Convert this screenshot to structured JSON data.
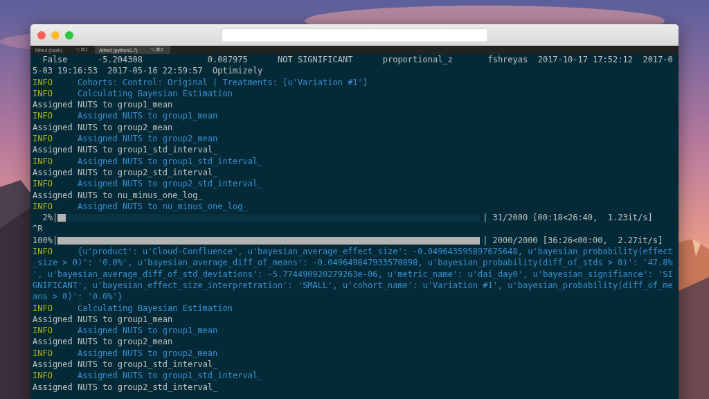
{
  "tabs": [
    {
      "label": "Alfred (bash)",
      "shortcut": "⌥⌘1",
      "selected": false
    },
    {
      "label": "Alfred (python2.7)",
      "shortcut": "⌥⌘2",
      "selected": true
    }
  ],
  "terminal": {
    "lines": [
      {
        "kind": "plain",
        "text": "  False      -5.204308             0.087975      NOT SIGNIFICANT      proportional_z       fshreyas  2017-10-17 17:52:12  2017-0"
      },
      {
        "kind": "plain",
        "text": "5-03 19:16:53  2017-05-16 22:59:57  Optimizely"
      },
      {
        "kind": "info",
        "level": "INFO",
        "text": "Cohorts: Control: Original | Treatments: [u'Variation #1']"
      },
      {
        "kind": "info",
        "level": "INFO",
        "text": "Calculating Bayesian Estimation"
      },
      {
        "kind": "plain",
        "text": "Assigned NUTS to group1_mean"
      },
      {
        "kind": "info",
        "level": "INFO",
        "text": "Assigned NUTS to group1_mean"
      },
      {
        "kind": "plain",
        "text": "Assigned NUTS to group2_mean"
      },
      {
        "kind": "info",
        "level": "INFO",
        "text": "Assigned NUTS to group2_mean"
      },
      {
        "kind": "plain",
        "text": "Assigned NUTS to group1_std_interval_"
      },
      {
        "kind": "info",
        "level": "INFO",
        "text": "Assigned NUTS to group1_std_interval_"
      },
      {
        "kind": "plain",
        "text": "Assigned NUTS to group2_std_interval_"
      },
      {
        "kind": "info",
        "level": "INFO",
        "text": "Assigned NUTS to group2_std_interval_"
      },
      {
        "kind": "plain",
        "text": "Assigned NUTS to nu_minus_one_log_"
      },
      {
        "kind": "info",
        "level": "INFO",
        "text": "Assigned NUTS to nu_minus_one_log_"
      },
      {
        "kind": "progress",
        "percent": "  2%|",
        "level": 0.02,
        "stats": "| 31/2000 [00:18<26:40,  1.23it/s]"
      },
      {
        "kind": "plain",
        "text": "^R"
      },
      {
        "kind": "progress",
        "percent": "100%|",
        "level": 1,
        "stats": "| 2000/2000 [36:26<00:00,  2.27it/s]"
      },
      {
        "kind": "info",
        "level": "INFO",
        "text": "{u'product': u'Cloud-Confluence', u'bayesian_average_effect_size': -0.049643595897675648, u'bayesian_probability(effect"
      },
      {
        "kind": "continued",
        "text": "_size > 0)': '0.0%', u'bayesian_average_diff_of_means': -0.049649847933570898, u'bayesian_probability(diff_of_stds > 0)': '47.8%"
      },
      {
        "kind": "continued",
        "text": "', u'bayesian_average_diff_of_std_deviations': -5.774490920279263e-06, u'metric_name': u'dai_day0', u'bayesian_signifiance': 'SI"
      },
      {
        "kind": "continued",
        "text": "GNIFICANT', u'bayesian_effect_size_interpretration': 'SMALL', u'cohort_name': u'Variation #1', u'bayesian_probability(diff_of_me"
      },
      {
        "kind": "continued",
        "text": "ans > 0)': '0.0%'}"
      },
      {
        "kind": "info",
        "level": "INFO",
        "text": "Calculating Bayesian Estimation"
      },
      {
        "kind": "plain",
        "text": "Assigned NUTS to group1_mean"
      },
      {
        "kind": "info",
        "level": "INFO",
        "text": "Assigned NUTS to group1_mean"
      },
      {
        "kind": "plain",
        "text": "Assigned NUTS to group2_mean"
      },
      {
        "kind": "info",
        "level": "INFO",
        "text": "Assigned NUTS to group2_mean"
      },
      {
        "kind": "plain",
        "text": "Assigned NUTS to group1_std_interval_"
      },
      {
        "kind": "info",
        "level": "INFO",
        "text": "Assigned NUTS to group1_std_interval_"
      },
      {
        "kind": "plain",
        "text": "Assigned NUTS to group2_std_interval_"
      }
    ]
  }
}
